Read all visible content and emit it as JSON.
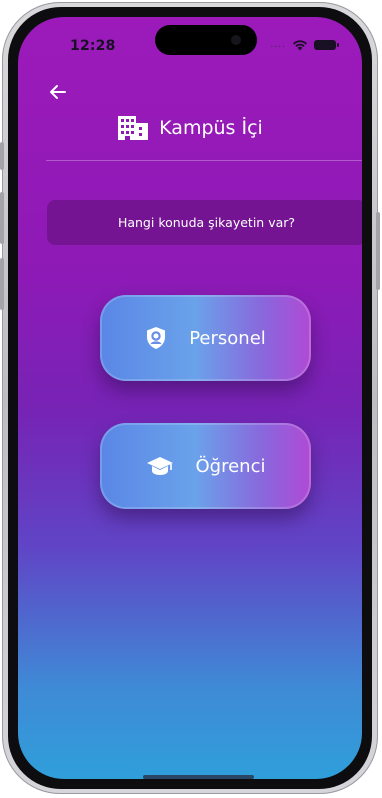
{
  "status_bar": {
    "time": "12:28",
    "signal_icon": "signal-dots-icon",
    "wifi_icon": "wifi-icon",
    "battery_icon": "battery-icon"
  },
  "header": {
    "back_icon": "arrow-left-icon",
    "title_icon": "building-icon",
    "title": "Kampüs İçi"
  },
  "prompt": {
    "text": "Hangi konuda şikayetin var?"
  },
  "options": [
    {
      "label": "Personel",
      "icon": "shield-person-icon"
    },
    {
      "label": "Öğrenci",
      "icon": "graduation-cap-icon"
    }
  ],
  "colors": {
    "background_top": "#9c1aba",
    "background_bottom": "#2f9fda",
    "button_left": "#5a86e6",
    "button_right": "#b04ad4",
    "text": "#ffffff"
  }
}
